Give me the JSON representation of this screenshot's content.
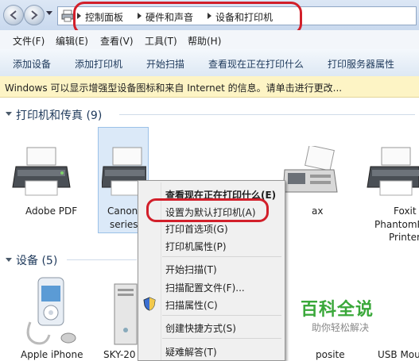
{
  "address_bar": {
    "crumbs": [
      "控制面板",
      "硬件和声音",
      "设备和打印机"
    ]
  },
  "menu": [
    "文件(F)",
    "编辑(E)",
    "查看(V)",
    "工具(T)",
    "帮助(H)"
  ],
  "commands": [
    "添加设备",
    "添加打印机",
    "开始扫描",
    "查看现在正在打印什么",
    "打印服务器属性"
  ],
  "info_bar": "Windows 可以显示增强型设备图标和来自 Internet 的信息。请单击进行更改...",
  "printers_group": {
    "title": "打印机和传真 (9)",
    "items": [
      {
        "label": "Adobe PDF"
      },
      {
        "label_line1": "Canon",
        "label_line2": "series"
      },
      {
        "label": "ax"
      },
      {
        "label_line1": "Foxit",
        "label_line2": "PhantomP",
        "label_line3": "Printer"
      }
    ]
  },
  "devices_group": {
    "title": "设备 (5)",
    "items": [
      {
        "label": "Apple iPhone"
      },
      {
        "label": "SKY-20"
      },
      {
        "label": "posite"
      },
      {
        "label": "USB Mou"
      }
    ]
  },
  "context_menu": {
    "items": [
      {
        "label": "查看现在正在打印什么(E)",
        "bold": true
      },
      {
        "label": "设置为默认打印机(A)"
      },
      {
        "label": "打印首选项(G)"
      },
      {
        "label": "打印机属性(P)"
      },
      {
        "label": "开始扫描(T)"
      },
      {
        "label": "扫描配置文件(F)..."
      },
      {
        "label": "扫描属性(C)",
        "icon": "shield-icon"
      },
      {
        "label": "创建快捷方式(S)"
      },
      {
        "label": "疑难解答(T)"
      }
    ]
  },
  "watermark": {
    "title": "百科全说",
    "subtitle": "助你轻松解决"
  },
  "colors": {
    "highlight_oval": "#d21f2a",
    "watermark_green": "#3aa83a"
  }
}
